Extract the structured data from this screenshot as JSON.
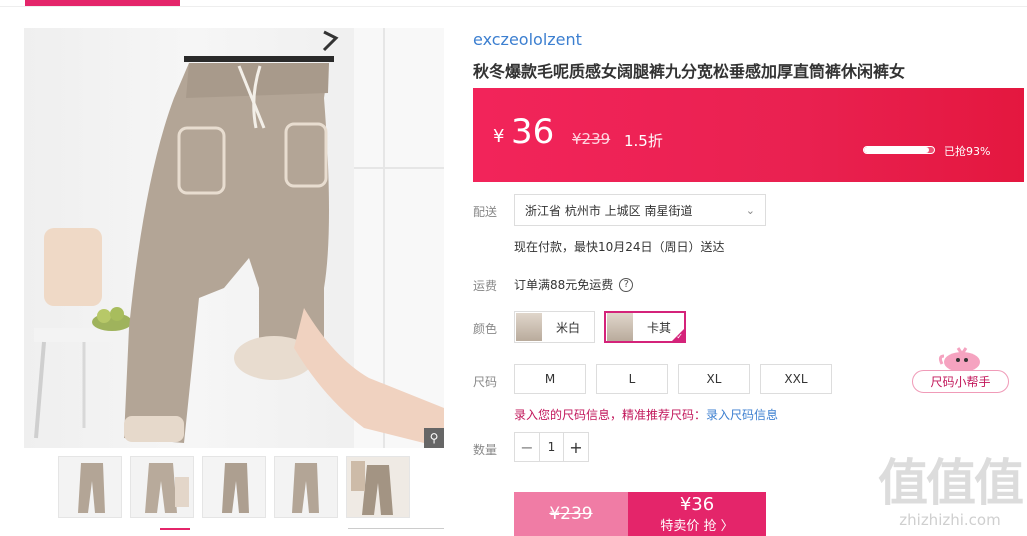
{
  "shop": {
    "name": "exczeololzent"
  },
  "product": {
    "title": "秋冬爆款毛呢质感女阔腿裤九分宽松垂感加厚直筒裤休闲裤女"
  },
  "price": {
    "currency": "¥",
    "current": "36",
    "original": "¥239",
    "discount": "1.5折",
    "sold_label": "已抢93%",
    "sold_percent": 93
  },
  "delivery": {
    "label": "配送",
    "address": "浙江省 杭州市 上城区 南星街道",
    "note": "现在付款，最快10月24日（周日）送达"
  },
  "shipping": {
    "label": "运费",
    "text": "订单满88元免运费"
  },
  "color": {
    "label": "颜色",
    "options": [
      {
        "name": "米白",
        "selected": false
      },
      {
        "name": "卡其",
        "selected": true
      }
    ]
  },
  "size": {
    "label": "尺码",
    "options": [
      "M",
      "L",
      "XL",
      "XXL"
    ],
    "tip": "录入您的尺码信息，精准推荐尺码：",
    "tip_link": "录入尺码信息"
  },
  "quantity": {
    "label": "数量",
    "value": "1",
    "minus": "−",
    "plus": "+"
  },
  "buy": {
    "original_price": "¥239",
    "price": "¥36",
    "action": "特卖价 抢 〉"
  },
  "helper": {
    "label": "尺码小帮手"
  },
  "watermark": {
    "big": "值值值",
    "small": "zhizhizhi.com"
  },
  "icons": {
    "zoom": "magnifier-icon",
    "chevron": "chevron-down-icon",
    "help": "question-icon",
    "check": "check-icon"
  },
  "colors": {
    "accent": "#e4256a",
    "banner": "#f2245a",
    "link": "#3c7fd0"
  }
}
